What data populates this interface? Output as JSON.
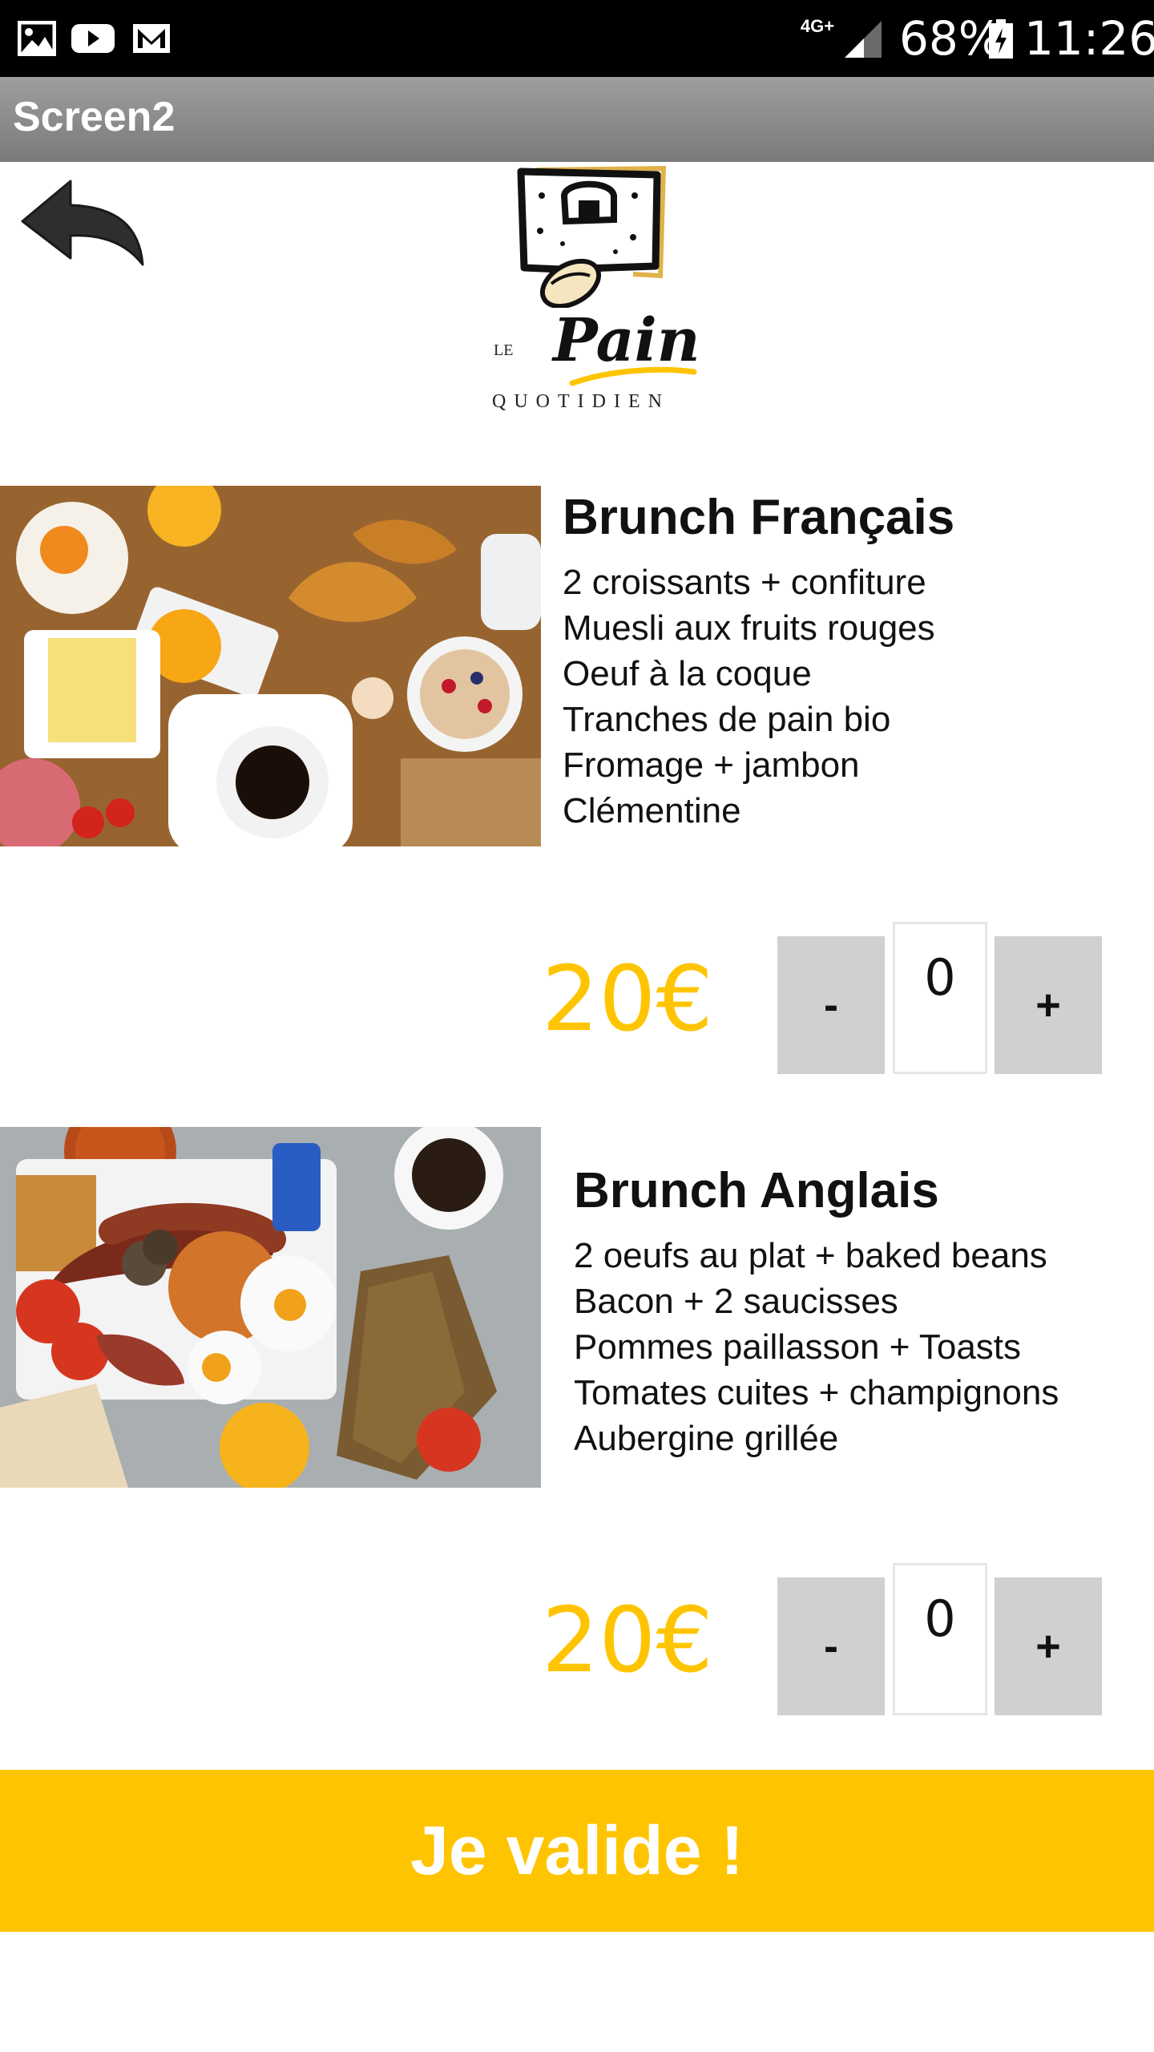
{
  "status_bar": {
    "network": "4G+",
    "battery": "68%",
    "time": "11:26",
    "icons": [
      "gallery-icon",
      "youtube-icon",
      "gmail-icon",
      "signal-icon",
      "battery-charging-icon"
    ]
  },
  "app_bar": {
    "title": "Screen2"
  },
  "logo": {
    "le": "LE",
    "word": "Pain",
    "sub": "QUOTIDIEN"
  },
  "products": [
    {
      "title": "Brunch Français",
      "lines": [
        "2 croissants + confiture",
        "Muesli aux fruits rouges",
        "Oeuf à la coque",
        "Tranches de pain bio",
        "Fromage + jambon",
        "Clémentine"
      ],
      "price": "20€",
      "minus": "-",
      "qty": "0",
      "plus": "+"
    },
    {
      "title": "Brunch Anglais",
      "lines": [
        "2 oeufs au plat + baked beans",
        "Bacon + 2 saucisses",
        "Pommes paillasson + Toasts",
        "Tomates cuites + champignons",
        "Aubergine grillée"
      ],
      "price": "20€",
      "minus": "-",
      "qty": "0",
      "plus": "+"
    }
  ],
  "validate_label": "Je valide !",
  "colors": {
    "accent": "#ffc400",
    "stepper": "#d0d0d0",
    "appbar": "#8c8c8c"
  }
}
